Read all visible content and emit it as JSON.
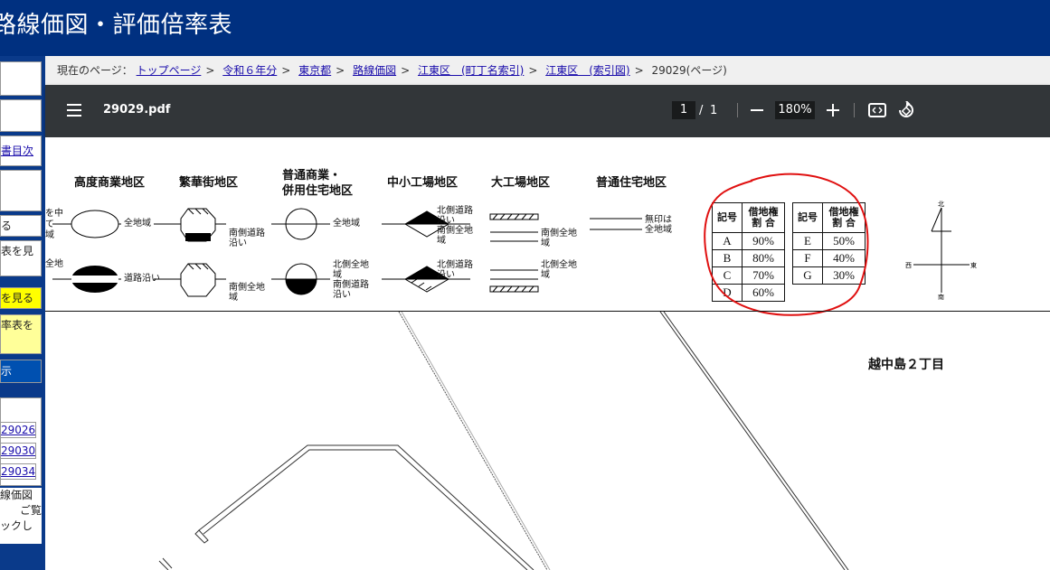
{
  "header": {
    "title": "路線価図・評価倍率表"
  },
  "sidebar": {
    "items": [
      "書目次",
      "る",
      "表を見",
      "を見る",
      "率表を",
      "示",
      "29026",
      "29030",
      "29034",
      "線価図",
      "ご覧",
      "ックし"
    ],
    "cut_texts": [
      "を中",
      "て",
      "域",
      "全地"
    ]
  },
  "breadcrumb": {
    "prefix": "現在のページ：",
    "links": [
      "トップページ",
      "令和６年分",
      "東京都",
      "路線価図",
      "江東区　(町丁名索引)",
      "江東区　(索引図)"
    ],
    "current": "29029(ページ)",
    "separator": ">"
  },
  "pdf_toolbar": {
    "menu_icon": "hamburger-menu-icon",
    "filename": "29029.pdf",
    "page_current": "1",
    "page_sep": "/",
    "page_total": "1",
    "zoom": "180%",
    "zoom_out_icon": "minus-icon",
    "zoom_in_icon": "plus-icon",
    "fit_icon": "fit-page-icon",
    "rotate_icon": "rotate-icon"
  },
  "legend": {
    "districts": [
      "高度商業地区",
      "繁華街地区",
      "普通商業・",
      "併用住宅地区",
      "中小工場地区",
      "大工場地区",
      "普通住宅地区"
    ],
    "labels": {
      "whole_area": "全地域",
      "along_road": "道路沿い",
      "south_road_1": "南側道路",
      "south_road_2": "沿い",
      "south_all_1": "南側全地",
      "south_all_2": "域",
      "north_all_1": "北側全地",
      "north_all_2": "域",
      "north_all_3": "南側道路",
      "north_all_4": "沿い",
      "n_road_1": "北側道路",
      "n_road_2": "沿い",
      "n_road_3": "南側全地",
      "n_road_4": "域",
      "n_road2_1": "北側道路",
      "n_road2_2": "沿い",
      "big_south_1": "南側全地",
      "big_south_2": "域",
      "big_north_1": "北側全地",
      "big_north_2": "域",
      "no_mark_1": "無印は",
      "no_mark_2": "全地域"
    }
  },
  "ratio_table": {
    "header_symbol": "記号",
    "header_ratio_1": "借地権",
    "header_ratio_2": "割 合",
    "left": [
      {
        "symbol": "A",
        "ratio": "90%"
      },
      {
        "symbol": "B",
        "ratio": "80%"
      },
      {
        "symbol": "C",
        "ratio": "70%"
      },
      {
        "symbol": "D",
        "ratio": "60%"
      }
    ],
    "right": [
      {
        "symbol": "E",
        "ratio": "50%"
      },
      {
        "symbol": "F",
        "ratio": "40%"
      },
      {
        "symbol": "G",
        "ratio": "30%"
      }
    ]
  },
  "compass": {
    "north": "北",
    "south": "南",
    "east": "東",
    "west": "西"
  },
  "map": {
    "area_name": "越中島２丁目"
  },
  "colors": {
    "header_bg": "#003080",
    "sidebar_bg": "#0a3a8a",
    "toolbar_bg": "#323639",
    "highlight_yellow": "#ffff00",
    "annotation_red": "#e01010"
  }
}
